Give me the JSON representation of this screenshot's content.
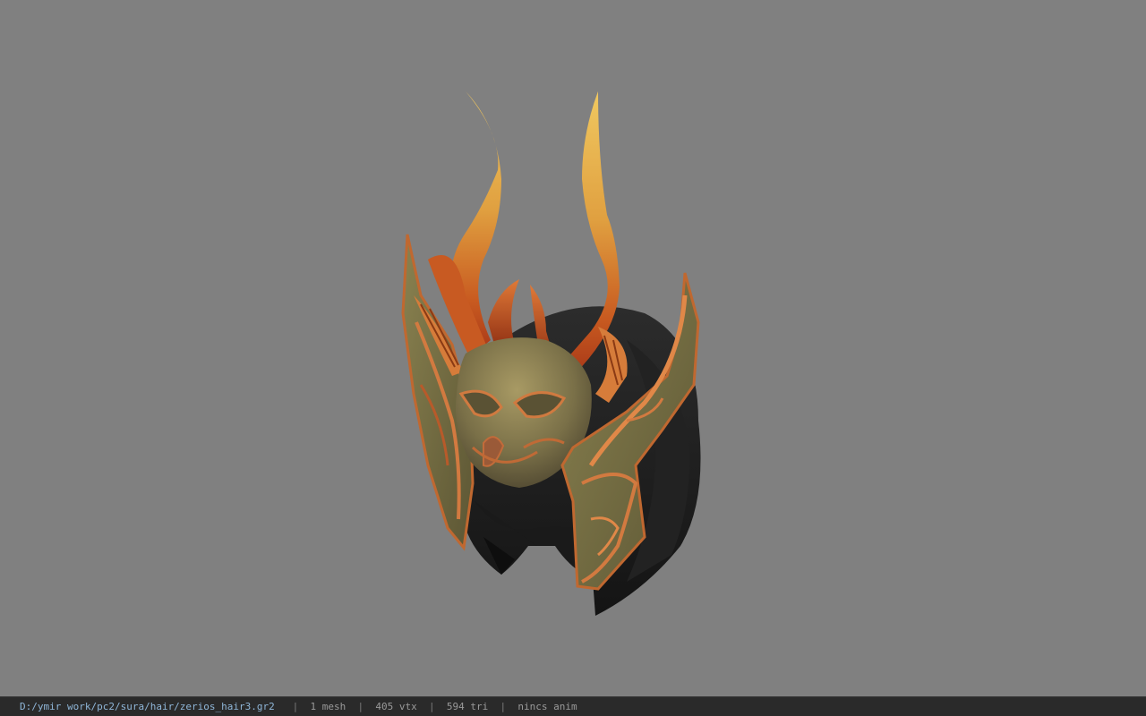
{
  "viewer": {
    "background_color": "#808080",
    "model": "zerios_hair3"
  },
  "status_bar": {
    "file_path": "D:/ymir work/pc2/sura/hair/zerios_hair3.gr2",
    "separator": "|",
    "mesh_count": "1 mesh",
    "vertex_count": "405 vtx",
    "triangle_count": "594 tri",
    "anim_status": "nincs anim",
    "path_color": "#8fb6d8",
    "bar_color": "#2a2a2a"
  }
}
